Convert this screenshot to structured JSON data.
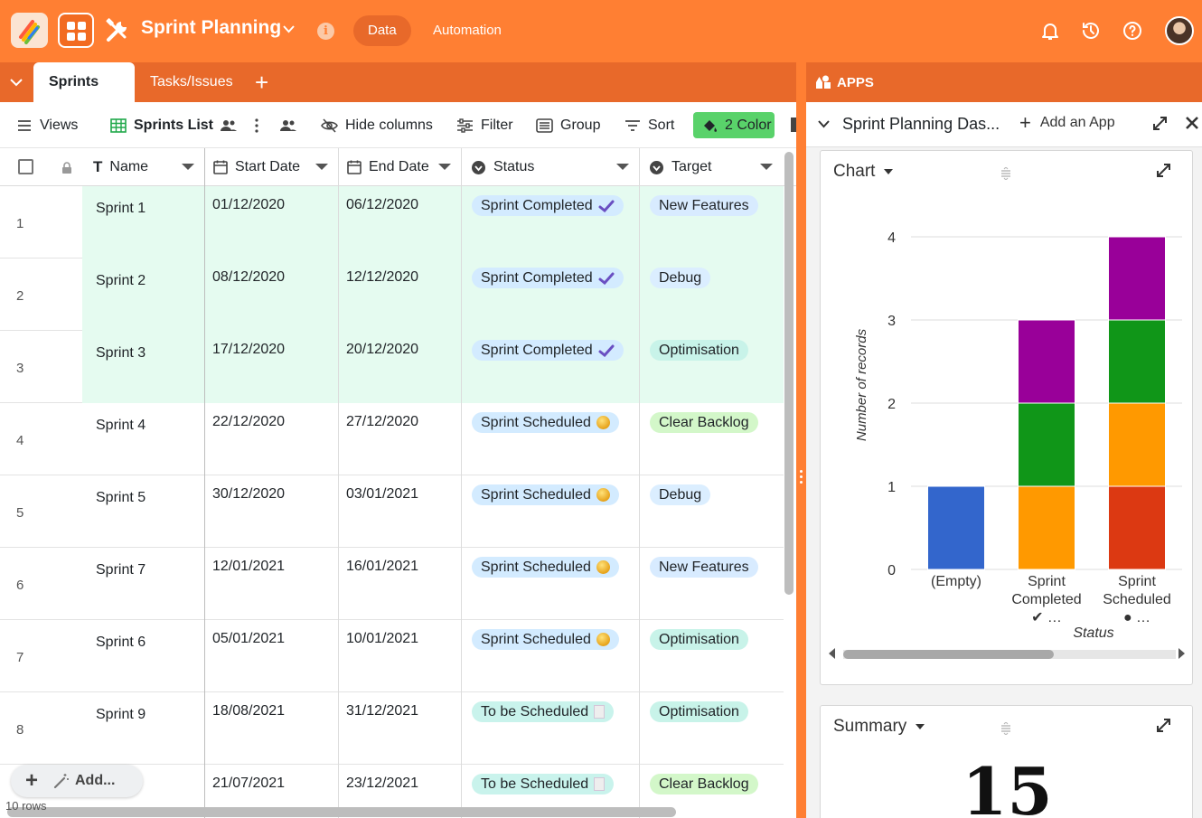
{
  "header": {
    "app_title": "Sprint Planning",
    "tabs": [
      {
        "label": "Data",
        "active": true
      },
      {
        "label": "Automation",
        "active": false
      }
    ],
    "icons": [
      "bell-icon",
      "history-icon",
      "help-icon"
    ]
  },
  "tables_tabs": [
    {
      "label": "Sprints",
      "active": true
    },
    {
      "label": "Tasks/Issues",
      "active": false
    }
  ],
  "toolbar": {
    "views_label": "Views",
    "view_name": "Sprints List",
    "hide_columns": "Hide columns",
    "filter": "Filter",
    "group": "Group",
    "sort": "Sort",
    "color": "2 Color"
  },
  "columns": {
    "name": "Name",
    "start": "Start Date",
    "end": "End Date",
    "status": "Status",
    "target": "Target"
  },
  "rows": [
    {
      "num": "1",
      "name": "Sprint 1",
      "start": "01/12/2020",
      "end": "06/12/2020",
      "status": "Sprint Completed",
      "status_icon": "check-icon",
      "target": "New Features",
      "target_color": "#d8ebff",
      "highlight": true
    },
    {
      "num": "2",
      "name": "Sprint 2",
      "start": "08/12/2020",
      "end": "12/12/2020",
      "status": "Sprint Completed",
      "status_icon": "check-icon",
      "target": "Debug",
      "target_color": "#dbeeff",
      "highlight": true
    },
    {
      "num": "3",
      "name": "Sprint 3",
      "start": "17/12/2020",
      "end": "20/12/2020",
      "status": "Sprint Completed",
      "status_icon": "check-icon",
      "target": "Optimisation",
      "target_color": "#c8f3e9",
      "highlight": true
    },
    {
      "num": "4",
      "name": "Sprint 4",
      "start": "22/12/2020",
      "end": "27/12/2020",
      "status": "Sprint Scheduled",
      "status_icon": "coin-icon",
      "target": "Clear Backlog",
      "target_color": "#d3f7c9",
      "highlight": false
    },
    {
      "num": "5",
      "name": "Sprint 5",
      "start": "30/12/2020",
      "end": "03/01/2021",
      "status": "Sprint Scheduled",
      "status_icon": "coin-icon",
      "target": "Debug",
      "target_color": "#dbeeff",
      "highlight": false
    },
    {
      "num": "6",
      "name": "Sprint 7",
      "start": "12/01/2021",
      "end": "16/01/2021",
      "status": "Sprint Scheduled",
      "status_icon": "coin-icon",
      "target": "New Features",
      "target_color": "#d8ebff",
      "highlight": false
    },
    {
      "num": "7",
      "name": "Sprint 6",
      "start": "05/01/2021",
      "end": "10/01/2021",
      "status": "Sprint Scheduled",
      "status_icon": "coin-icon",
      "target": "Optimisation",
      "target_color": "#c8f3e9",
      "highlight": false
    },
    {
      "num": "8",
      "name": "Sprint 9",
      "start": "18/08/2021",
      "end": "31/12/2021",
      "status": "To be Scheduled",
      "status_icon": "memo-icon",
      "target": "Optimisation",
      "target_color": "#c8f3e9",
      "highlight": false
    },
    {
      "num": "",
      "name": "",
      "start": "21/07/2021",
      "end": "23/12/2021",
      "status": "To be Scheduled",
      "status_icon": "memo-icon",
      "target": "Clear Backlog",
      "target_color": "#d3f7c9",
      "highlight": false
    }
  ],
  "footer": {
    "add_label": "Add...",
    "rows_count": "10 rows"
  },
  "apps": {
    "header": "APPS",
    "dashboard_title": "Sprint Planning Das...",
    "add_app": "Add an App",
    "chart_card_title": "Chart",
    "summary_card_title": "Summary",
    "summary_value": "15"
  },
  "chart_data": {
    "type": "bar",
    "stacked": true,
    "categories": [
      "(Empty)",
      "Sprint Completed ✔ …",
      "Sprint Scheduled ● …"
    ],
    "category_lines": [
      [
        "(Empty)"
      ],
      [
        "Sprint",
        "Completed",
        "✔ …"
      ],
      [
        "Sprint",
        "Scheduled",
        "● …"
      ]
    ],
    "segments": [
      [
        {
          "value": 1,
          "color": "#3366cc"
        }
      ],
      [
        {
          "value": 1,
          "color": "#ff9900"
        },
        {
          "value": 1,
          "color": "#109618"
        },
        {
          "value": 1,
          "color": "#990099"
        }
      ],
      [
        {
          "value": 1,
          "color": "#dc3912"
        },
        {
          "value": 1,
          "color": "#ff9900"
        },
        {
          "value": 1,
          "color": "#109618"
        },
        {
          "value": 1,
          "color": "#990099"
        }
      ]
    ],
    "xlabel": "Status",
    "ylabel": "Number of records",
    "ylim": [
      0,
      4
    ],
    "yticks": [
      0,
      1,
      2,
      3,
      4
    ],
    "grid": true
  }
}
